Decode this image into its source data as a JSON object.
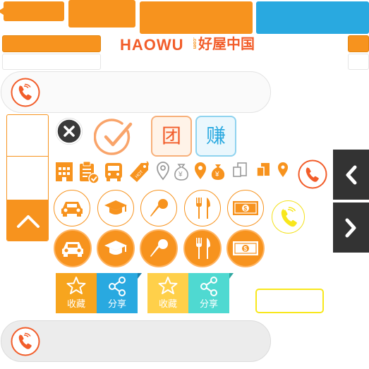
{
  "brand": {
    "logo_en": "HAOWU",
    "logo_com": ".com",
    "logo_cn": "好屋中国",
    "orange": "#f7931e",
    "red_orange": "#f25d2a",
    "blue": "#29a9e0",
    "teal": "#4fd9d1",
    "yellow": "#f8e71c",
    "dark": "#333333"
  },
  "badges": {
    "group_buy": "团",
    "earn": "赚"
  },
  "icons_small": [
    "building-icon",
    "clipboard-check-icon",
    "bus-icon",
    "hot-tag-icon",
    "location-outline-icon",
    "money-bag-outline-icon",
    "location-orange-icon",
    "money-bag-orange-icon",
    "stack-gray-icon",
    "stack-orange-icon",
    "location-small-orange-icon",
    "phone-circle-icon"
  ],
  "icons_large": [
    "car-icon",
    "graduation-cap-icon",
    "microphone-icon",
    "fork-knife-icon",
    "money-bill-icon"
  ],
  "share_cards": [
    {
      "fav_label": "收藏",
      "share_label": "分享",
      "fav_color": "#f7a51e",
      "share_color": "#29a9e0"
    },
    {
      "fav_label": "收藏",
      "share_label": "分享",
      "fav_color": "#ffd04a",
      "share_color": "#4fd9d1"
    }
  ]
}
